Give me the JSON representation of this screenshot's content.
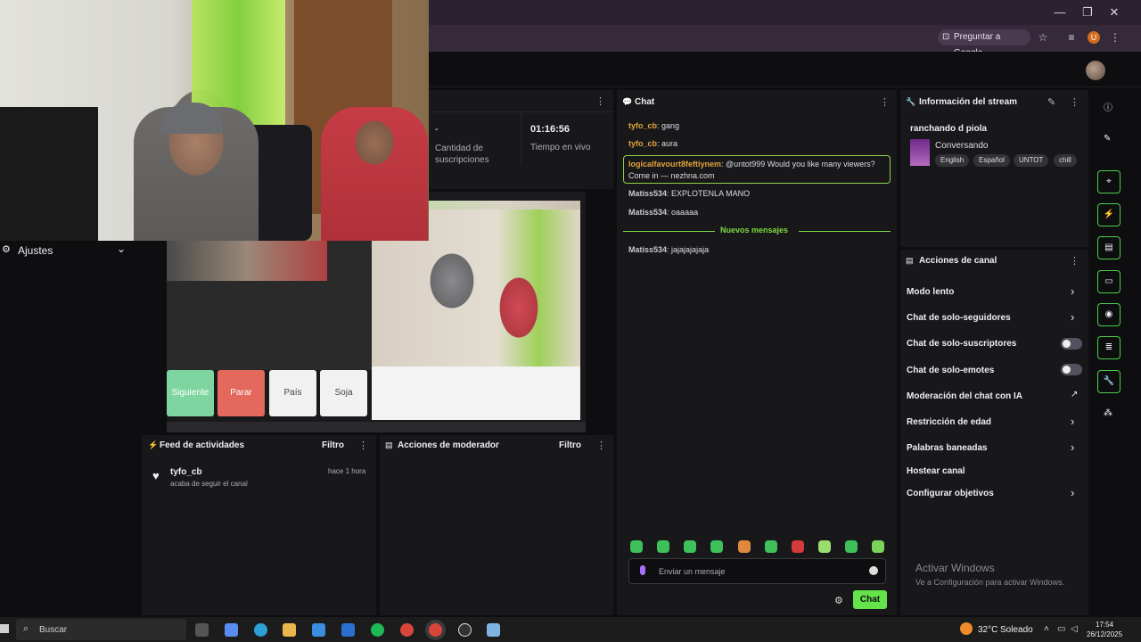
{
  "browser": {
    "ask_google": "Preguntar a Google",
    "profile_initial": "U"
  },
  "sidebar": {
    "title": "Ajustes"
  },
  "preview": {
    "btn_next": "Siguiente",
    "btn_stop": "Parar",
    "btn_country": "País",
    "btn_soja": "Soja"
  },
  "stats": {
    "subs_value": "-",
    "subs_label": "Cantidad de suscripciones",
    "live_value": "01:16:56",
    "live_label": "Tiempo en vivo"
  },
  "feed": {
    "title": "Feed de actividades",
    "filter": "Filtro",
    "items": [
      {
        "user": "tyfo_cb",
        "time": "hace 1 hora",
        "action": "acaba de seguir el canal"
      }
    ]
  },
  "mod_actions": {
    "title": "Acciones de moderador",
    "filter": "Filtro"
  },
  "chat": {
    "title": "Chat",
    "messages": [
      {
        "user": "tyfo_cb",
        "text": "gang",
        "color": "#e2a33a"
      },
      {
        "user": "tyfo_cb",
        "text": "aura",
        "color": "#e2a33a"
      },
      {
        "user": "logicalfavourt8feftiynem",
        "text": "@untot999 Would you like many viewers? Come in — nezhna.com",
        "color": "#e2a33a"
      },
      {
        "user": "Matiss534",
        "text": "EXPLOTENLA MANO",
        "color": "#c9c9d0"
      },
      {
        "user": "Matiss534",
        "text": "oaaaaa",
        "color": "#c9c9d0"
      },
      {
        "user": "Matiss534",
        "text": "jajajajajaja",
        "color": "#c9c9d0"
      }
    ],
    "new_messages": "Nuevos mensajes",
    "input_placeholder": "Enviar un mensaje",
    "send_label": "Chat",
    "accent": "#65e34a"
  },
  "stream_info": {
    "title": "Información del stream",
    "stream_title": "ranchando d piola",
    "category": "Conversando",
    "tags": [
      "English",
      "Español",
      "UNTOT",
      "chill"
    ]
  },
  "channel_actions": {
    "title": "Acciones de canal",
    "items": [
      {
        "label": "Modo lento",
        "control": "chevron"
      },
      {
        "label": "Chat de solo-seguidores",
        "control": "chevron"
      },
      {
        "label": "Chat de solo-suscriptores",
        "control": "toggle",
        "on": false
      },
      {
        "label": "Chat de solo-emotes",
        "control": "toggle",
        "on": false
      },
      {
        "label": "Moderación del chat con IA",
        "control": "external"
      },
      {
        "label": "Restricción de edad",
        "control": "chevron"
      },
      {
        "label": "Palabras baneadas",
        "control": "chevron"
      },
      {
        "label": "Hostear canal",
        "control": "none"
      },
      {
        "label": "Configurar objetivos",
        "control": "chevron"
      }
    ]
  },
  "windows_notice": {
    "title": "Activar Windows",
    "sub": "Ve a Configuración para activar Windows."
  },
  "taskbar": {
    "search": "Buscar",
    "temp": "32°C",
    "condition": "Soleado",
    "time": "17:54",
    "date": "26/12/2025"
  }
}
